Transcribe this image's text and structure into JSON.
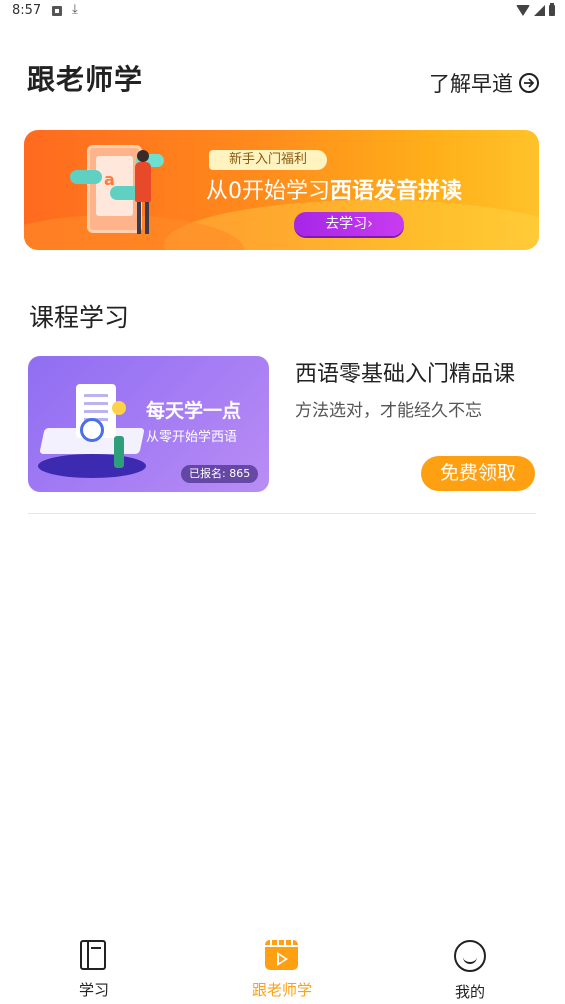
{
  "status_bar": {
    "time": "8:57",
    "icons": [
      "a-icon",
      "download-icon",
      "wifi-icon",
      "signal-icon",
      "battery-icon"
    ]
  },
  "header": {
    "title": "跟老师学",
    "learn_more": "了解早道",
    "learn_more_icon": "arrow-right-circle-icon"
  },
  "banner": {
    "tag": "新手入门福利",
    "line_prefix": "从0开始学习",
    "line_highlight": "西语发音拼读",
    "cta": "去学习",
    "cta_arrow": "›",
    "phone_letter": "a",
    "colors": {
      "start": "#ff6a1f",
      "end": "#ffc22a",
      "cta": "#a626e6"
    }
  },
  "section": {
    "title": "课程学习"
  },
  "course": {
    "thumb_title": "每天学一点",
    "thumb_subtitle": "从零开始学西语",
    "enrolled": "已报名: 865",
    "name": "西语零基础入门精品课",
    "description": "方法选对，才能经久不忘",
    "button": "免费领取"
  },
  "tabbar": {
    "active": "跟老师学",
    "accent": "#ff9f12",
    "tabs": [
      {
        "label": "学习",
        "icon": "book-icon"
      },
      {
        "label": "跟老师学",
        "icon": "video-icon"
      },
      {
        "label": "我的",
        "icon": "smile-icon"
      }
    ]
  }
}
